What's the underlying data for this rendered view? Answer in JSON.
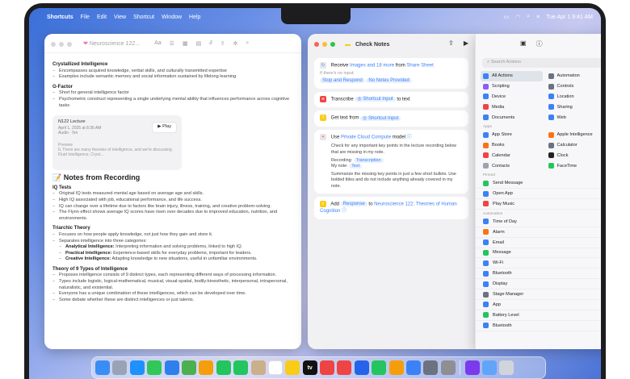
{
  "menubar": {
    "app": "Shortcuts",
    "items": [
      "File",
      "Edit",
      "View",
      "Shortcut",
      "Window",
      "Help"
    ],
    "clock": "Tue Apr 1  9:41 AM"
  },
  "notes": {
    "title": "Neuroscience 122...",
    "toolbar_icons": [
      "Aa",
      "list-icon",
      "table-icon",
      "attach-icon",
      "media-icon",
      "share-icon",
      "search-icon"
    ],
    "crystallized": {
      "heading": "Crystallized Intelligence",
      "bullets": [
        "Encompasses acquired knowledge, verbal skills, and culturally transmitted expertise",
        "Examples include semantic memory and social information sustained by lifelong learning"
      ]
    },
    "gfactor": {
      "heading": "G-Factor",
      "bullets": [
        "Short for general intelligence factor",
        "Psychometric construct representing a single underlying mental ability that influences performance across cognitive tasks"
      ]
    },
    "recording": {
      "title": "N122 Lecture",
      "date": "April 1, 2025 at 8:36 AM",
      "meta": "Audio · 5m",
      "play": "Play",
      "preview_label": "Preview",
      "preview": "IL There are many theories of intelligence, and we're discussing Fluid Intelligence, Cryst..."
    },
    "section_title": "Notes from Recording",
    "iq": {
      "heading": "IQ Tests",
      "bullets": [
        "Original IQ tests measured mental age based on average age and skills.",
        "High IQ associated with job, educational performance, and life success.",
        "IQ can change over a lifetime due to factors like brain injury, illness, training, and creative problem-solving.",
        "The Flynn effect shows average IQ scores have risen over decades due to improved education, nutrition, and environments."
      ]
    },
    "triarchic": {
      "heading": "Triarchic Theory",
      "bullets": [
        "Focuses on how people apply knowledge, not just how they gain and store it.",
        "Separates intelligence into three categories:"
      ],
      "sub": [
        {
          "b": "Analytical Intelligence:",
          "t": " Interpreting information and solving problems, linked to high IQ."
        },
        {
          "b": "Practical Intelligence:",
          "t": " Experience-based skills for everyday problems, important for leaders."
        },
        {
          "b": "Creative Intelligence:",
          "t": " Adapting knowledge to new situations, useful in unfamiliar environments."
        }
      ]
    },
    "nine": {
      "heading": "Theory of 9 Types of Intelligence",
      "bullets": [
        "Proposes intelligence consists of 9 distinct types, each representing different ways of processing information.",
        "Types include logistic, logical-mathematical, musical, visual-spatial, bodily-kinesthetic, interpersonal, intrapersonal, naturalistic, and existential.",
        "Everyone has a unique combination of these intelligences, which can be developed over time.",
        "Some debate whether these are distinct intelligences or just talents."
      ]
    }
  },
  "shortcut": {
    "title": "Check Notes",
    "receive": {
      "label": "Receive",
      "types": "Images and 18 more",
      "from": "from",
      "source": "Share Sheet",
      "if_none": "If there's no input:",
      "opt1": "Stop and Respond",
      "opt2": "No Notes Provided"
    },
    "transcribe": {
      "label": "Transcribe",
      "input": "Shortcut Input",
      "to": "to text"
    },
    "gettext": {
      "label": "Get text from",
      "input": "Shortcut Input"
    },
    "use": {
      "label": "Use",
      "model": "Private Cloud Compute",
      "suffix": "model",
      "p1": "Check for any important key points in the lecture recording below that are missing in my note.",
      "rec_label": "Recording:",
      "rec_tok": "Transcription",
      "note_label": "My note:",
      "note_tok": "Text",
      "p2": "Summarize the missing key points in just a few short bullets. Use bolded titles and do not include anything already covered in my note."
    },
    "add": {
      "label": "Add",
      "response": "Response",
      "to": "to",
      "target": "Neuroscience 122: Theories of Human Cognition"
    }
  },
  "library": {
    "search_placeholder": "Search Actions",
    "categories": [
      {
        "label": "All Actions",
        "color": "#3b82f6",
        "selected": true
      },
      {
        "label": "Automation",
        "color": "#6b7280"
      },
      {
        "label": "Scripting",
        "color": "#8b5cf6"
      },
      {
        "label": "Controls",
        "color": "#6b7280"
      },
      {
        "label": "Device",
        "color": "#3b82f6"
      },
      {
        "label": "Location",
        "color": "#3b82f6"
      },
      {
        "label": "Media",
        "color": "#ef4444"
      },
      {
        "label": "Sharing",
        "color": "#3b82f6"
      },
      {
        "label": "Documents",
        "color": "#3b82f6"
      },
      {
        "label": "Web",
        "color": "#3b82f6"
      }
    ],
    "apps_label": "Apps",
    "apps": [
      {
        "label": "App Store",
        "color": "#3b82f6"
      },
      {
        "label": "Apple Intelligence",
        "color": "#f97316"
      },
      {
        "label": "Books",
        "color": "#f97316"
      },
      {
        "label": "Calculator",
        "color": "#6b7280"
      },
      {
        "label": "Calendar",
        "color": "#ef4444"
      },
      {
        "label": "Clock",
        "color": "#222222"
      },
      {
        "label": "Contacts",
        "color": "#9ca3af"
      },
      {
        "label": "FaceTime",
        "color": "#22c55e"
      }
    ],
    "pinned_label": "Pinned",
    "pinned": [
      {
        "label": "Send Message",
        "color": "#22c55e"
      },
      {
        "label": "Open App",
        "color": "#3b82f6"
      },
      {
        "label": "Play Music",
        "color": "#ef4444"
      }
    ],
    "automation_label": "Automation",
    "automation": [
      {
        "label": "Time of Day",
        "color": "#3b82f6"
      },
      {
        "label": "Alarm",
        "color": "#f97316"
      },
      {
        "label": "Email",
        "color": "#3b82f6"
      },
      {
        "label": "Message",
        "color": "#22c55e"
      },
      {
        "label": "Wi-Fi",
        "color": "#3b82f6"
      },
      {
        "label": "Bluetooth",
        "color": "#3b82f6"
      },
      {
        "label": "Display",
        "color": "#3b82f6"
      },
      {
        "label": "Stage Manager",
        "color": "#6b7280"
      },
      {
        "label": "App",
        "color": "#3b82f6"
      },
      {
        "label": "Battery Level",
        "color": "#22c55e"
      },
      {
        "label": "Bluetooth",
        "color": "#3b82f6"
      }
    ]
  },
  "dock": {
    "apps": [
      {
        "name": "finder",
        "color": "#3a8df5"
      },
      {
        "name": "launchpad",
        "color": "#9aa3b5"
      },
      {
        "name": "safari",
        "color": "#1e90ff"
      },
      {
        "name": "messages",
        "color": "#31c759"
      },
      {
        "name": "mail",
        "color": "#2f80ed"
      },
      {
        "name": "maps",
        "color": "#4caf50"
      },
      {
        "name": "photos",
        "color": "#f59e0b"
      },
      {
        "name": "facetime",
        "color": "#22c55e"
      },
      {
        "name": "phone",
        "color": "#22c55e"
      },
      {
        "name": "contacts",
        "color": "#c9b08a"
      },
      {
        "name": "calendar",
        "color": "#ffffff"
      },
      {
        "name": "notes",
        "color": "#facc15"
      },
      {
        "name": "tv",
        "color": "#111111"
      },
      {
        "name": "music",
        "color": "#ef4444"
      },
      {
        "name": "news",
        "color": "#ef4444"
      },
      {
        "name": "keynote",
        "color": "#2563eb"
      },
      {
        "name": "numbers",
        "color": "#22c55e"
      },
      {
        "name": "pages",
        "color": "#f59e0b"
      },
      {
        "name": "app-store",
        "color": "#3b82f6"
      },
      {
        "name": "iphone-mirroring",
        "color": "#6b7280"
      },
      {
        "name": "settings",
        "color": "#8e8e93"
      },
      {
        "name": "shortcuts",
        "color": "#7c3aed"
      },
      {
        "name": "downloads",
        "color": "#60a5fa"
      },
      {
        "name": "trash",
        "color": "#d1d5db"
      }
    ],
    "tv_label": "tv"
  }
}
